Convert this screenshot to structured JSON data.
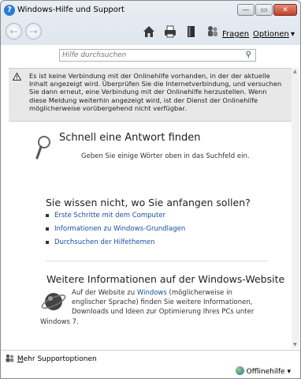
{
  "window": {
    "title": "Windows-Hilfe und Support",
    "minimize_glyph": "—",
    "maximize_glyph": "▭",
    "close_glyph": "✕"
  },
  "toolbar": {
    "back_glyph": "←",
    "forward_glyph": "→",
    "icons": [
      "home-icon",
      "print-icon",
      "browse-help-icon",
      "ask-icon"
    ],
    "ask_label": "Fragen",
    "options_label": "Optionen",
    "options_arrow": "▾"
  },
  "search": {
    "placeholder": "Hilfe durchsuchen",
    "icon_glyph": "⚲"
  },
  "warning": {
    "text": "Es ist keine Verbindung mit der Onlinehilfe vorhanden, in der der aktuelle Inhalt angezeigt wird. Überprüfen Sie die Internetverbindung, und versuchen Sie dann erneut, eine Verbindung mit der Onlinehilfe herzustellen. Wenn diese Meldung weiterhin angezeigt wird, ist der Dienst der Onlinehilfe möglicherweise vorübergehend nicht verfügbar."
  },
  "quick_answer": {
    "title": "Schnell eine Antwort finden",
    "description": "Geben Sie einige Wörter oben in das Suchfeld ein."
  },
  "start": {
    "title": "Sie wissen nicht, wo Sie anfangen sollen?",
    "links": [
      "Erste Schritte mit dem Computer",
      "Informationen zu Windows-Grundlagen",
      "Durchsuchen der Hilfethemen"
    ]
  },
  "more_info": {
    "title": "Weitere Informationen auf der Windows-Website",
    "text_before": "Auf der Website zu ",
    "link_text": "Windows",
    "text_after": " (möglicherweise in englischer Sprache) finden Sie weitere Informationen, Downloads und Ideen zur Optimierung Ihres PCs unter Windows 7."
  },
  "footer": {
    "more_support_underlined": "M",
    "more_support_rest": "ehr Supportoptionen",
    "offline_label": "Offlinehilfe",
    "offline_arrow": "▾"
  }
}
